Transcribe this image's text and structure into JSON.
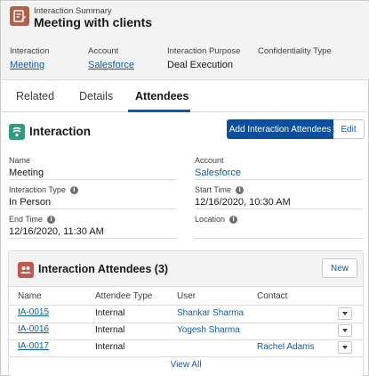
{
  "header": {
    "kicker": "Interaction Summary",
    "title": "Meeting with clients",
    "fields": [
      {
        "label": "Interaction",
        "value": "Meeting"
      },
      {
        "label": "Account",
        "value": "Salesforce"
      },
      {
        "label": "Interaction Purpose",
        "value": "Deal Execution"
      },
      {
        "label": "Confidentiality Type",
        "value": ""
      }
    ]
  },
  "tabs": [
    {
      "label": "Related"
    },
    {
      "label": "Details"
    },
    {
      "label": "Attendees",
      "active": true
    }
  ],
  "interaction_card": {
    "title": "Interaction",
    "add_button": "Add Interaction Attendees",
    "edit_button": "Edit",
    "fields": {
      "name": {
        "label": "Name",
        "value": "Meeting"
      },
      "account": {
        "label": "Account",
        "value": "Salesforce"
      },
      "type": {
        "label": "Interaction Type",
        "value": "In Person"
      },
      "start": {
        "label": "Start Time",
        "value": "12/16/2020, 10:30 AM"
      },
      "end": {
        "label": "End Time",
        "value": "12/16/2020, 11:30 AM"
      },
      "location": {
        "label": "Location",
        "value": ""
      }
    }
  },
  "attendees": {
    "title": "Interaction Attendees (3)",
    "new_button": "New",
    "columns": [
      "Name",
      "Attendee Type",
      "User",
      "Contact"
    ],
    "rows": [
      {
        "name": "IA-0015",
        "type": "Internal",
        "user": "Shankar Sharma",
        "contact": ""
      },
      {
        "name": "IA-0016",
        "type": "Internal",
        "user": "Yogesh Sharma",
        "contact": ""
      },
      {
        "name": "IA-0017",
        "type": "Internal",
        "user": "",
        "contact": "Rachel Adams"
      }
    ],
    "view_all": "View All"
  },
  "icons": {
    "record": "interaction-summary-icon",
    "interaction": "interaction-icon",
    "attendees": "attendees-icon",
    "info": "info-icon",
    "row_menu": "chevron-down-icon"
  },
  "colors": {
    "brand_blue": "#0b4f9c",
    "link": "#0b5cab",
    "record_icon": "#b1614a",
    "interaction_icon": "#2e9c7f",
    "attendees_icon": "#c2574f"
  }
}
